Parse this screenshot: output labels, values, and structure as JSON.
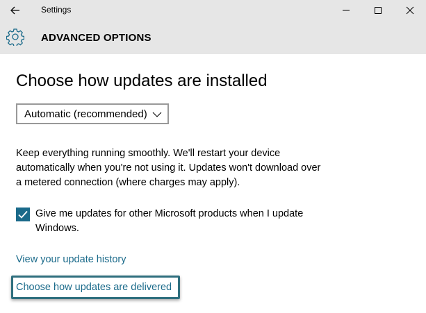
{
  "window": {
    "title": "Settings"
  },
  "header": {
    "title": "ADVANCED OPTIONS",
    "icon": "gear-icon"
  },
  "main": {
    "heading": "Choose how updates are installed",
    "install_mode": {
      "selected": "Automatic (recommended)"
    },
    "description": "Keep everything running smoothly. We'll restart your device automatically when you're not using it. Updates won't download over a metered connection (where charges may apply).",
    "microsoft_products": {
      "checked": true,
      "label": "Give me updates for other Microsoft products when I update Windows."
    },
    "links": {
      "history": "View your update history",
      "delivered": "Choose how updates are delivered"
    }
  },
  "colors": {
    "chrome_bg": "#e6e6e6",
    "accent": "#1a6a8a",
    "focus_ring": "#2f6f7e"
  }
}
